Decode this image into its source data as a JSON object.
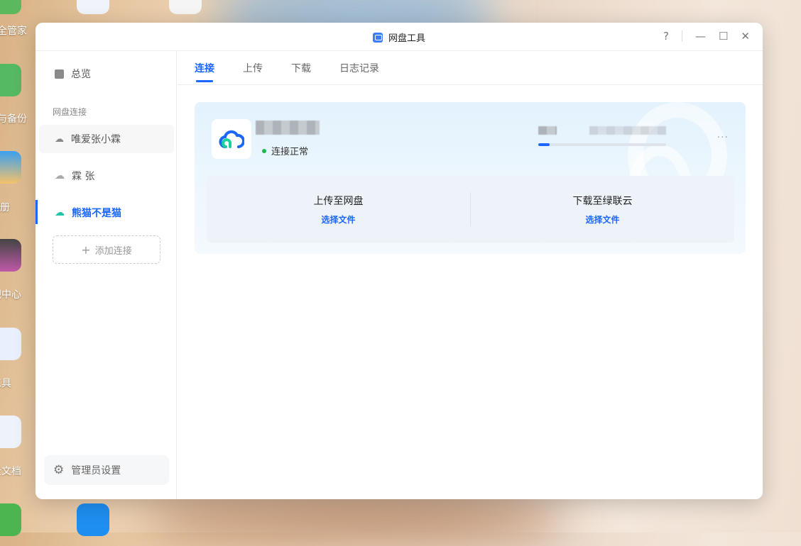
{
  "desktop": {
    "labels": [
      "全管家",
      "与备份",
      "相册",
      "视中心",
      "工具",
      "云文档"
    ]
  },
  "window": {
    "title": "网盘工具",
    "help": "?",
    "minimize": "—",
    "maximize": "☐",
    "close": "✕"
  },
  "sidebar": {
    "overview": "总览",
    "section": "网盘连接",
    "connections": [
      {
        "label": "唯爱张小霖",
        "icon": "cloud-cluster-icon"
      },
      {
        "label": "霖 张",
        "icon": "cloud-icon"
      },
      {
        "label": "熊猫不是猫",
        "icon": "ugreen-cloud-icon",
        "active": true
      }
    ],
    "add": "添加连接",
    "admin": "管理员设置"
  },
  "tabs": [
    {
      "label": "连接",
      "active": true
    },
    {
      "label": "上传"
    },
    {
      "label": "下载"
    },
    {
      "label": "日志记录"
    }
  ],
  "card": {
    "status": "连接正常",
    "storage_used_fraction": 0.09,
    "upload": {
      "title": "上传至网盘",
      "link": "选择文件"
    },
    "download": {
      "title": "下载至绿联云",
      "link": "选择文件"
    }
  },
  "colors": {
    "accent": "#1a66ff",
    "ok": "#1db74d"
  }
}
